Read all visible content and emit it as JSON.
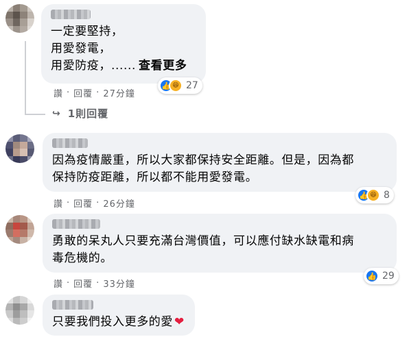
{
  "comments": [
    {
      "text": "一定要堅持，\n用愛發電，\n用愛防疫，......",
      "see_more": "查看更多",
      "actions": {
        "like": "讚",
        "reply": "回覆",
        "time": "27分鐘"
      },
      "reaction_count": "27",
      "reply_link": "1則回覆"
    },
    {
      "text": "因為疫情嚴重，所以大家都保持安全距離。但是，因為都\n保持防疫距離，所以都不能用愛發電。",
      "actions": {
        "like": "讚",
        "reply": "回覆",
        "time": "26分鐘"
      },
      "reaction_count": "8"
    },
    {
      "text": "勇敢的呆丸人只要充滿台灣價值，可以應付缺水缺電和病\n毒危機的。",
      "actions": {
        "like": "讚",
        "reply": "回覆",
        "time": "33分鐘"
      },
      "reaction_count": "29"
    },
    {
      "text": "只要我們投入更多的愛"
    }
  ],
  "separator": "·",
  "icons": {
    "like": "thumbs-up-icon",
    "haha": "laughing-face-icon",
    "heart": "heart-emoji-icon",
    "reply_arrow": "reply-arrow-icon"
  },
  "colors": {
    "like": "#1877f2",
    "haha": "#f7b125",
    "heart": "#e41e3f",
    "bubble": "#f0f2f5",
    "meta": "#65676b"
  }
}
